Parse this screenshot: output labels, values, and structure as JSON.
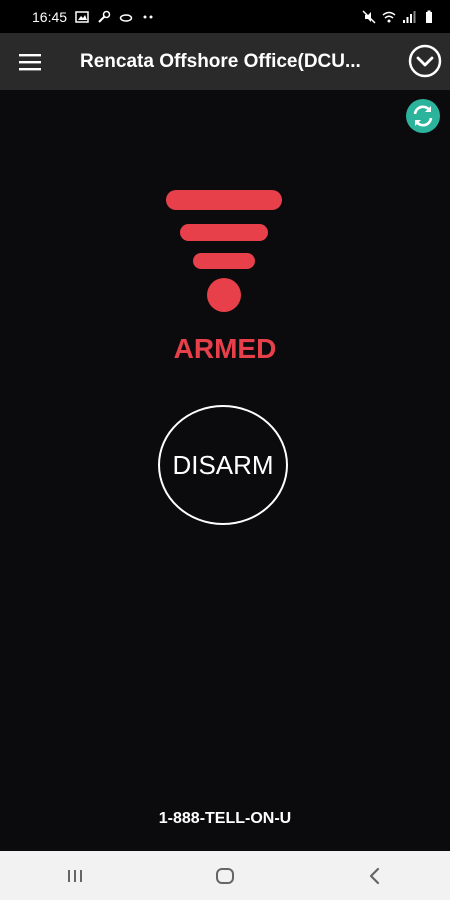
{
  "status_bar": {
    "time": "16:45",
    "left_icons": [
      "image-icon",
      "wrench-icon",
      "cloud-icon",
      "more-dots-icon"
    ],
    "right_icons": [
      "mute-icon",
      "wifi-icon",
      "signal-icon",
      "battery-icon"
    ]
  },
  "app_bar": {
    "title": "Rencata Offshore Office(DCU...",
    "menu_icon": "hamburger-menu-icon",
    "dropdown_icon": "chevron-down-circle-icon"
  },
  "refresh": {
    "icon": "refresh-icon",
    "color": "#2bb39b"
  },
  "alarm": {
    "icon": "alarm-signal-icon",
    "status": "ARMED",
    "color": "#e8404a"
  },
  "disarm_button": {
    "label": "DISARM"
  },
  "footer": {
    "phone": "1-888-TELL-ON-U"
  },
  "nav_bar": {
    "items": [
      "recent-apps-icon",
      "home-icon",
      "back-icon"
    ]
  }
}
